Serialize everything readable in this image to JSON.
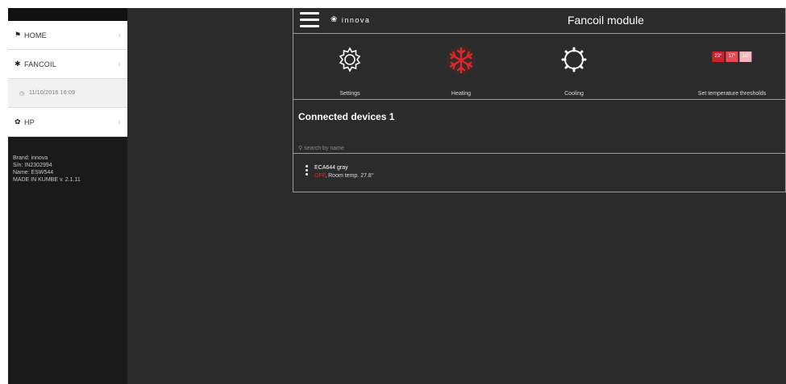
{
  "sidebar": {
    "items": [
      {
        "label": "HOME",
        "icon": "home-icon"
      },
      {
        "label": "FANCOIL",
        "icon": "fan-icon"
      },
      {
        "label": "11/10/2016 16:09",
        "icon": "clock-icon"
      },
      {
        "label": "HP",
        "icon": "hp-icon"
      }
    ],
    "info": {
      "brand": "Brand: innova",
      "sn": "S/n: IN2302994",
      "name": "Name: ESW544",
      "made": "MADE IN KUMBE v. 2.1.11"
    }
  },
  "header": {
    "logo_text": "innova",
    "title": "Fancoil module"
  },
  "modes": [
    {
      "label": "Settings",
      "icon": "gear-icon"
    },
    {
      "label": "Heating",
      "icon": "snowflake-icon",
      "color": "#e02828"
    },
    {
      "label": "Cooling",
      "icon": "cog-ring-icon"
    },
    {
      "label": "Set temperature thresholds",
      "icon": "thresholds-icon"
    }
  ],
  "thresholds": [
    {
      "value": "23°",
      "color": "#d0202a"
    },
    {
      "value": "17°",
      "color": "#e84a55"
    },
    {
      "value": "10°",
      "color": "#f4b6ba"
    }
  ],
  "connected": {
    "title": "Connected devices 1",
    "search_placeholder": "search by name"
  },
  "device": {
    "name": "ECA644 gray",
    "status": "OFF",
    "room_temp": ", Room temp. 27.8°"
  },
  "colors": {
    "background": "#2b2b2b",
    "sidebar": "#1a1a1a",
    "accent_red": "#e02828"
  }
}
